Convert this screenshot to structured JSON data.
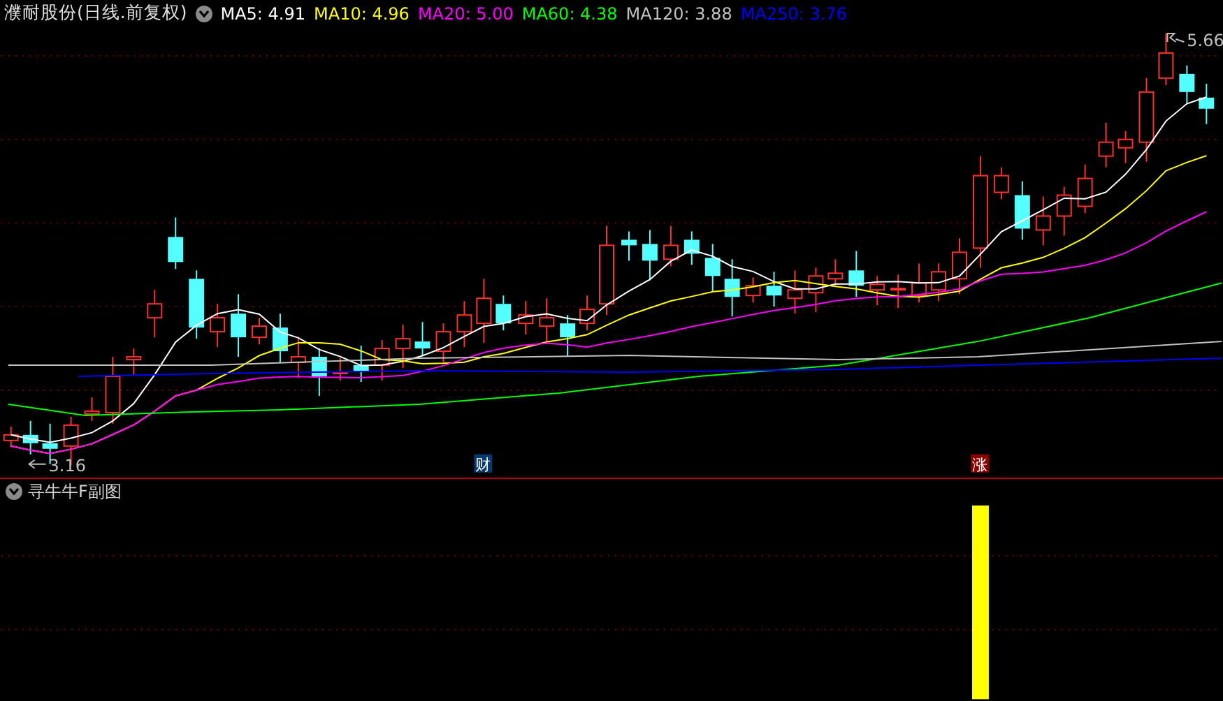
{
  "header": {
    "title": "濮耐股份(日线.前复权)",
    "legend": [
      {
        "label": "MA5: 4.91",
        "color": "#ffffff"
      },
      {
        "label": "MA10: 4.96",
        "color": "#ffff00"
      },
      {
        "label": "MA20: 5.00",
        "color": "#ff00ff"
      },
      {
        "label": "MA60: 4.38",
        "color": "#00ff00"
      },
      {
        "label": "MA120: 3.88",
        "color": "#c0c0c0"
      },
      {
        "label": "MA250: 3.76",
        "color": "#0000ff"
      }
    ]
  },
  "main_chart": {
    "low_label": "3.16",
    "high_label": "5.66",
    "events": [
      {
        "text": "财",
        "kind": "finance"
      },
      {
        "text": "涨",
        "kind": "rise"
      }
    ]
  },
  "sub_chart": {
    "title": "寻牛牛F副图"
  }
}
